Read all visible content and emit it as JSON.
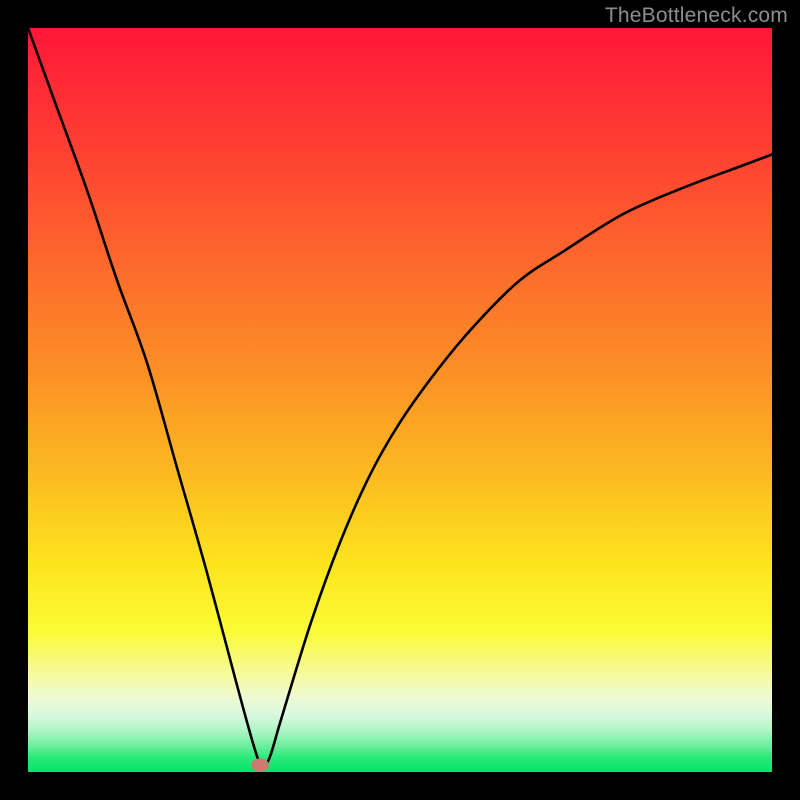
{
  "watermark": "TheBottleneck.com",
  "chart_data": {
    "type": "line",
    "title": "",
    "xlabel": "",
    "ylabel": "",
    "xlim": [
      0,
      100
    ],
    "ylim": [
      0,
      100
    ],
    "grid": false,
    "legend": false,
    "series": [
      {
        "name": "curve",
        "x": [
          0,
          4,
          8,
          12,
          16,
          20,
          24,
          28,
          30.5,
          31.5,
          32.5,
          34,
          38,
          42,
          46,
          50,
          55,
          60,
          66,
          72,
          80,
          88,
          96,
          100
        ],
        "y": [
          100,
          89,
          78,
          66,
          55,
          41,
          27,
          12,
          3,
          0.8,
          2,
          7,
          20,
          31,
          40,
          47,
          54,
          60,
          66,
          70,
          75,
          78.5,
          81.5,
          83
        ]
      }
    ],
    "marker": {
      "x": 31.2,
      "y": 0.9
    },
    "background_gradient": {
      "direction": "top-to-bottom",
      "stops": [
        {
          "pos": 0.0,
          "color": "#ff1637"
        },
        {
          "pos": 0.32,
          "color": "#fd6a2c"
        },
        {
          "pos": 0.6,
          "color": "#fcba21"
        },
        {
          "pos": 0.81,
          "color": "#fbfb35"
        },
        {
          "pos": 1.0,
          "color": "#00e465"
        }
      ]
    }
  }
}
